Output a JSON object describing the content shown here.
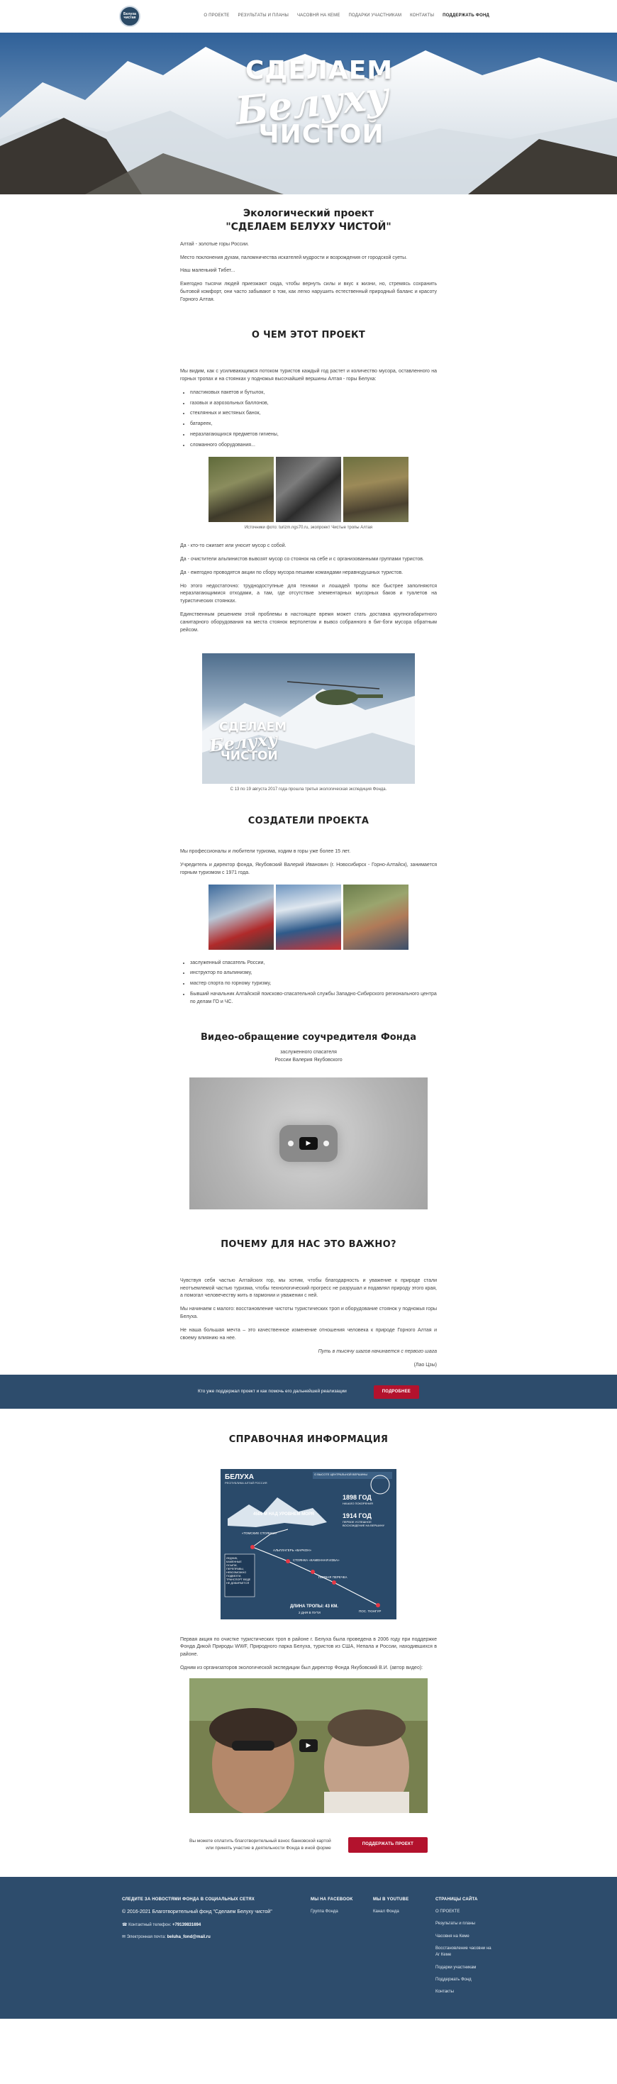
{
  "nav": {
    "logo_text": "Белуха чистая",
    "items": [
      "О ПРОЕКТЕ",
      "РЕЗУЛЬТАТЫ И ПЛАНЫ",
      "ЧАСОВНЯ НА КЕМЕ",
      "ПОДАРКИ УЧАСТНИКАМ",
      "КОНТАКТЫ",
      "ПОДДЕРЖАТЬ ФОНД"
    ]
  },
  "hero": {
    "line1": "СДЕЛАЕМ",
    "line2": "Белуху",
    "line3": "ЧИСТОЙ"
  },
  "intro": {
    "title_l1": "Экологический проект",
    "title_l2": "\"СДЕЛАЕМ БЕЛУХУ ЧИСТОЙ\"",
    "p1": "Алтай - золотые горы России.",
    "p2": "Место поклонения духам, паломничества искателей мудрости и возрождения от городской суеты.",
    "p3": "Наш маленький Тибет...",
    "p4": "Ежегодно тысячи людей приезжают сюда, чтобы вернуть силы и вкус к жизни, но, стремясь сохранить бытовой комфорт, они часто забывают о том, как легко нарушить естественный природный баланс и красоту Горного Алтая."
  },
  "about": {
    "title": "О ЧЕМ ЭТОТ ПРОЕКТ",
    "p1": "Мы видим, как с усиливающимся потоком туристов каждый год растет и количество мусора, оставленного на горных тропах и на стоянках у подножья высочайшей вершины Алтая - горы Белуха:",
    "list": [
      "пластиковых пакетов и бутылок,",
      "газовых и аэрозольных баллонов,",
      "стеклянных и жестяных банок,",
      "батареек,",
      "неразлагающихся предметов гигиены,",
      "сломанного оборудования..."
    ],
    "caption": "Источники фото: turizm.ngs70.ru, экопроект Чистые тропы Алтая",
    "p2": "Да - кто-то сжигает или уносит мусор с собой.",
    "p3": "Да - очистители альпинистов вывозят мусор со стоянок на себе и с организованными группами туристов.",
    "p4": "Да - ежегодно проводятся акции по сбору мусора пешими командами неравнодушных туристов.",
    "p5": "Но этого недостаточно: труднодоступные для техники и лошадей тропы все быстрее заполняются неразлагающимися отходами, а там, где отсутствие элементарных мусорных баков и туалетов на туристических стоянках.",
    "p6": "Единственным решением этой проблемы в настоящее время может стать доставка крупногабаритного санитарного оборудования на места стоянок вертолетом и вывоз собранного в биг-бэги мусора обратным рейсом.",
    "heli_l1": "СДЕЛАЕМ",
    "heli_l2": "Белуху",
    "heli_l3": "ЧИСТОЙ",
    "heli_caption": "С 13 по 19 августа 2017 года прошла третья экологическая экспедиция Фонда."
  },
  "creators": {
    "title": "СОЗДАТЕЛИ ПРОЕКТА",
    "p1": "Мы профессионалы и любители туризма, ходим в горы уже более 15 лет.",
    "p2": "Учредитель и директор фонда, Якубовский Валерий Иванович (г. Новосибирск - Горно-Алтайск), занимается горным туризмом с 1971 года.",
    "list": [
      "заслуженный спасатель России,",
      "инструктор по альпинизму,",
      "мастер спорта по горному туризму,",
      "Бывший начальник Алтайской поисково-спасательной службы Западно-Сибирского регионального центра по делам ГО и ЧС."
    ]
  },
  "video1": {
    "title": "Видео-обращение соучредителя Фонда",
    "sub1": "заслуженного спасателя",
    "sub2": "России Валерия Якубовского"
  },
  "why": {
    "title": "ПОЧЕМУ ДЛЯ НАС ЭТО ВАЖНО?",
    "p1": "Чувствуя себя частью Алтайских гор, мы хотим, чтобы благодарность и уважение к природе стали неотъемлемой частью туризма, чтобы технологический прогресс не разрушал и подавлял природу этого края, а помогал человечеству жить в гармонии и уважении с ней.",
    "p2": "Мы начинаем с малого: восстановление чистоты туристических троп и оборудование стоянок у подножья горы Белуха.",
    "p3": "Не наша большая мечта – это качественное изменение отношения человека к природе Горного Алтая и своему влиянию на нее.",
    "quote": "Путь в тысячу шагов начинается с первого шага",
    "quote_author": "(Лао Цзы)"
  },
  "band1": {
    "text": "Кто уже поддержал проект и как помочь его дальнейшей реализации",
    "button": "ПОДРОБНЕЕ"
  },
  "reference": {
    "title": "СПРАВОЧНАЯ ИНФОРМАЦИЯ",
    "map_title": "БЕЛУХА",
    "map_sub": "РЕСПУБЛИКА АЛТАЙ РОССИЯ",
    "map_header": "О ВЫСОТЕ ЦЕНТРАЛЬНОЙ ВЕРШИНЫ",
    "labels": {
      "alt": "4509 М НАД УРОВНЕМ МОРЯ",
      "y1898": "1898 ГОД",
      "y1898t": "НАЧАЛО ПОКОРЕНИЯ",
      "y1914": "1914 ГОД",
      "y1914t": "ПЕРВОЕ УСПЕШНОЕ ВОСХОЖДЕНИЕ НА ВЕРШИНУ",
      "tomsk": "«ТОМСКИЕ СТОЯНКИ»",
      "camp": "АЛЬПЛАГЕРЬ «ВАРКОН»",
      "stone": "СТОЯНКА «КАМЕННАЯ ИЗБА»",
      "pass": "ПЕРВАЯ ПЕРЕЧКА",
      "village": "ПОС. ТЮНГУР",
      "dist": "ДЛИНА ТРОПЫ: 43 КМ.",
      "days": "2 ДНЯ В ПУТИ",
      "note": "ЛЕДНИК, КАМЕННЫЕ ОСЫПИ, ПЕРЕПРАВЫ, НЕВОЗМОЖНО ПОДВЕЗТИ, ТРАНСПОРТ ВЕДЕ НЕ ДОБИРАЕТСЯ"
    },
    "p1": "Первая акция по очистке туристических троп в районе г. Белуха была проведена в 2006 году при поддержке Фонда Дикой Природы WWF, Природного парка Белуха, туристов из США, Непала и России, находившихся в районе.",
    "p2": "Одним из организаторов экологической экспедиции был директор Фонда Якубовский В.И. (автор видео):"
  },
  "band2": {
    "text_l1": "Вы можете оплатить благотворительный взнос банковской картой",
    "text_l2": "или принять участие в деятельности Фонда в иной форме",
    "button": "ПОДДЕРЖАТЬ ПРОЕКТ"
  },
  "footer": {
    "follow": "СЛЕДИТЕ ЗА НОВОСТЯМИ ФОНДА В СОЦИАЛЬНЫХ СЕТЯХ",
    "copyright": "© 2016-2021 Благотворительный фонд \"Сделаем Белуху чистой\"",
    "phone_label": "Контактный телефон:",
    "phone": "+79139831694",
    "email_label": "Электронная почта:",
    "email": "beluha_fond@mail.ru",
    "fb_head": "МЫ НА FACEBOOK",
    "fb_link": "Группа Фонда",
    "yt_head": "МЫ В YOUTUBE",
    "yt_link": "Канал Фонда",
    "pages_head": "СТРАНИЦЫ САЙТА",
    "pages": [
      "О ПРОЕКТЕ",
      "Результаты и планы",
      "Часовня на Кеме",
      "Восстановление часовни на Аг Кеме",
      "Подарки участникам",
      "Поддержать Фонд",
      "Контакты"
    ]
  }
}
